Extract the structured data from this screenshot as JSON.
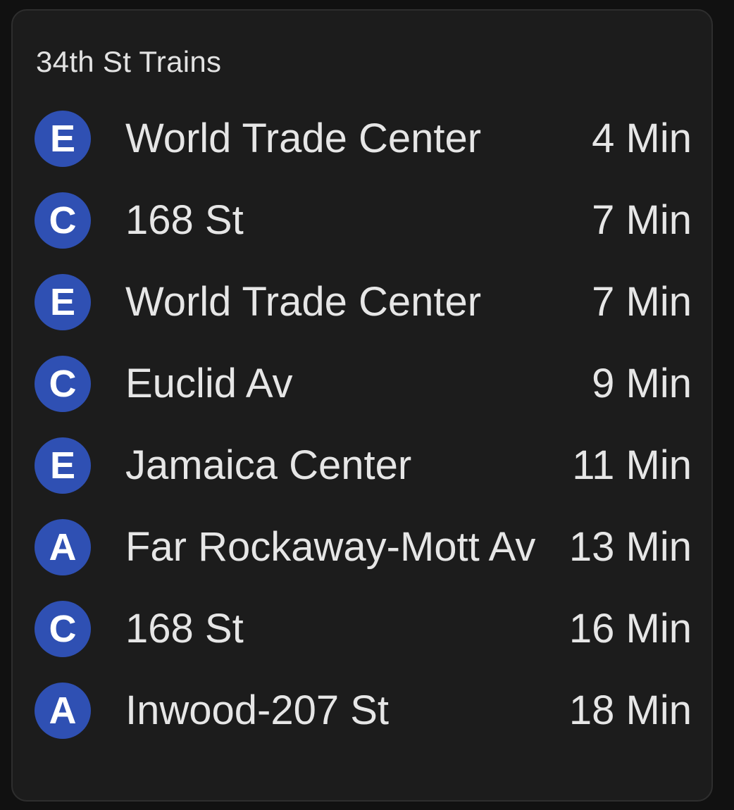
{
  "card": {
    "title": "34th St Trains"
  },
  "colors": {
    "card_background": "#1c1c1c",
    "page_background": "#111111",
    "badge_blue": "#2f50b3",
    "text": "#e6e6e6"
  },
  "departures": [
    {
      "line": "E",
      "destination": "World Trade Center",
      "eta": "4 Min"
    },
    {
      "line": "C",
      "destination": "168 St",
      "eta": "7 Min"
    },
    {
      "line": "E",
      "destination": "World Trade Center",
      "eta": "7 Min"
    },
    {
      "line": "C",
      "destination": "Euclid Av",
      "eta": "9 Min"
    },
    {
      "line": "E",
      "destination": "Jamaica Center",
      "eta": "11 Min"
    },
    {
      "line": "A",
      "destination": "Far Rockaway-Mott Av",
      "eta": "13 Min"
    },
    {
      "line": "C",
      "destination": "168 St",
      "eta": "16 Min"
    },
    {
      "line": "A",
      "destination": "Inwood-207 St",
      "eta": "18 Min"
    }
  ]
}
